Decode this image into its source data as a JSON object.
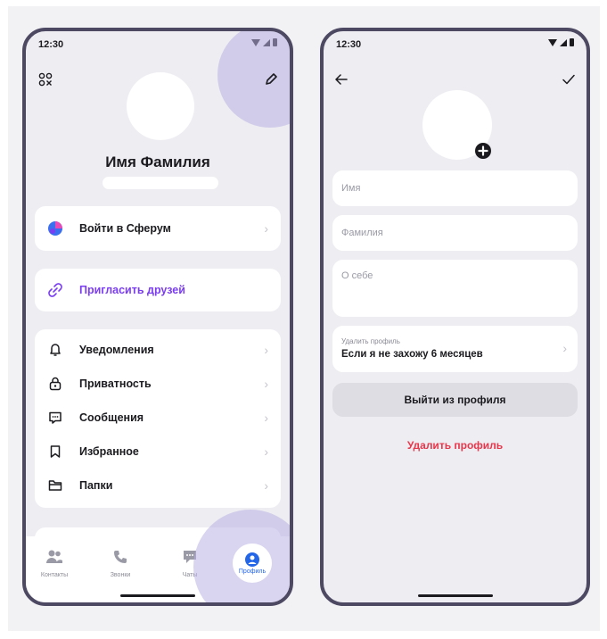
{
  "left": {
    "time": "12:30",
    "name": "Имя Фамилия",
    "sferum": "Войти в Сферум",
    "invite": "Пригласить друзей",
    "menu": [
      {
        "label": "Уведомления",
        "icon": "bell-icon"
      },
      {
        "label": "Приватность",
        "icon": "lock-icon"
      },
      {
        "label": "Сообщения",
        "icon": "message-icon"
      },
      {
        "label": "Избранное",
        "icon": "bookmark-icon"
      },
      {
        "label": "Папки",
        "icon": "folder-icon"
      }
    ],
    "tabs": [
      "Контакты",
      "Звонки",
      "Чаты",
      "Профиль"
    ]
  },
  "right": {
    "time": "12:30",
    "first_name_placeholder": "Имя",
    "last_name_placeholder": "Фамилия",
    "about_placeholder": "О себе",
    "delete_caption": "Удалить профиль",
    "delete_value": "Если я не захожу 6 месяцев",
    "logout": "Выйти из профиля",
    "delete_profile": "Удалить профиль"
  },
  "colors": {
    "frame": "#4e4963",
    "accent": "#7a3df2",
    "danger": "#e8364b",
    "tab_active": "#2466e8",
    "highlight": "#bab0e4"
  }
}
